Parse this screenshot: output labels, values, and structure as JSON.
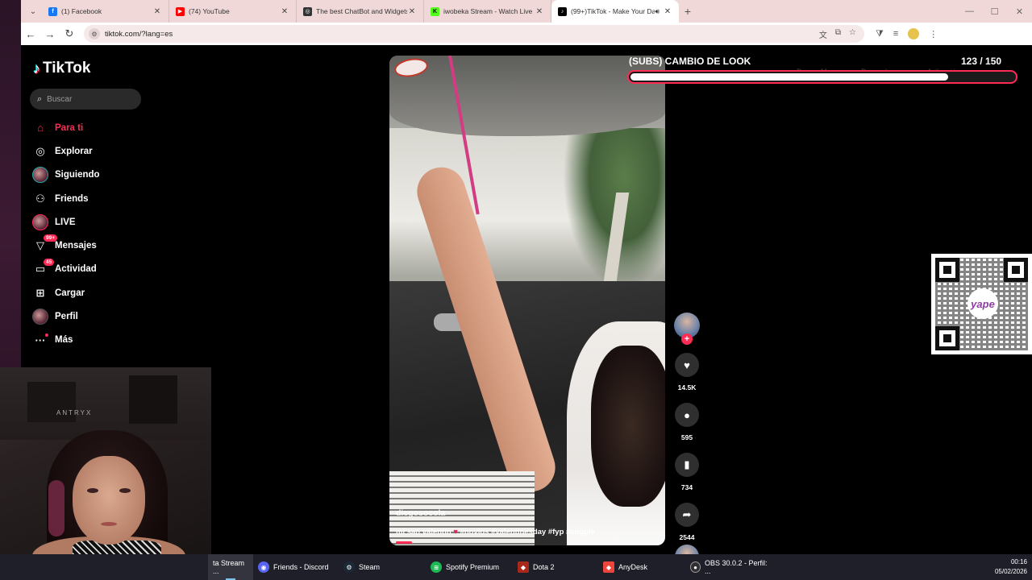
{
  "browser": {
    "tabs": [
      {
        "title": "(1) Facebook",
        "icon": "facebook-icon",
        "color": "#1877f2",
        "active": false
      },
      {
        "title": "(74) YouTube",
        "icon": "youtube-icon",
        "color": "#ff0000",
        "active": false
      },
      {
        "title": "The best ChatBot and Widgets",
        "icon": "chatbot-icon",
        "color": "#333333",
        "active": false
      },
      {
        "title": "iwobeka Stream - Watch Live o",
        "icon": "kick-icon",
        "color": "#53fc18",
        "active": false
      },
      {
        "title": "(99+)TikTok - Make Your Da",
        "icon": "tiktok-icon",
        "color": "#000000",
        "active": true
      }
    ],
    "url": "tiktok.com/?lang=es"
  },
  "tiktok": {
    "logo": "TikTok",
    "search_placeholder": "Buscar",
    "nav": [
      {
        "label": "Para ti",
        "icon": "home-icon",
        "active": true
      },
      {
        "label": "Explorar",
        "icon": "compass-icon",
        "active": false
      },
      {
        "label": "Siguiendo",
        "icon": "following-avatar",
        "active": false
      },
      {
        "label": "Friends",
        "icon": "friends-icon",
        "active": false
      },
      {
        "label": "LIVE",
        "icon": "live-avatar",
        "active": false
      },
      {
        "label": "Mensajes",
        "icon": "messages-icon",
        "active": false,
        "badge": "99+"
      },
      {
        "label": "Actividad",
        "icon": "activity-icon",
        "active": false,
        "badge": "45"
      },
      {
        "label": "Cargar",
        "icon": "upload-icon",
        "active": false
      },
      {
        "label": "Perfil",
        "icon": "profile-avatar",
        "active": false
      },
      {
        "label": "Más",
        "icon": "more-icon",
        "active": false
      }
    ],
    "video": {
      "author": "diegosocola",
      "caption": "mi san valentín",
      "hashtags": "#novios #valentinesday #fyp #couple"
    },
    "actions": {
      "likes": "14.5K",
      "comments": "595",
      "saves": "734",
      "shares": "2544"
    }
  },
  "overlay": {
    "goal_title": "(SUBS) CAMBIO DE LOOK",
    "goal_current": "123",
    "goal_separator": " / ",
    "goal_target": "150",
    "goal_progress": 0.82,
    "ghost": [
      "Droner M...",
      "Droner la...",
      "Aplicación ..."
    ],
    "qr_label": "yape"
  },
  "webcam": {
    "brand": "ANTRYX"
  },
  "taskbar": {
    "items": [
      {
        "label": "ta Stream ...",
        "icon": "browser-icon",
        "color": "#6a4bc4",
        "active": true
      },
      {
        "label": "Friends - Discord",
        "icon": "discord-icon",
        "color": "#5865f2",
        "active": false
      },
      {
        "label": "Steam",
        "icon": "steam-icon",
        "color": "#1b2838",
        "active": false
      },
      {
        "label": "Spotify Premium",
        "icon": "spotify-icon",
        "color": "#1db954",
        "active": false
      },
      {
        "label": "Dota 2",
        "icon": "dota-icon",
        "color": "#a8281c",
        "active": false
      },
      {
        "label": "AnyDesk",
        "icon": "anydesk-icon",
        "color": "#ef443b",
        "active": false
      },
      {
        "label": "OBS 30.0.2 - Perfil: ...",
        "icon": "obs-icon",
        "color": "#302e31",
        "active": false
      }
    ],
    "time": "00:16",
    "date": "05/02/2026"
  }
}
